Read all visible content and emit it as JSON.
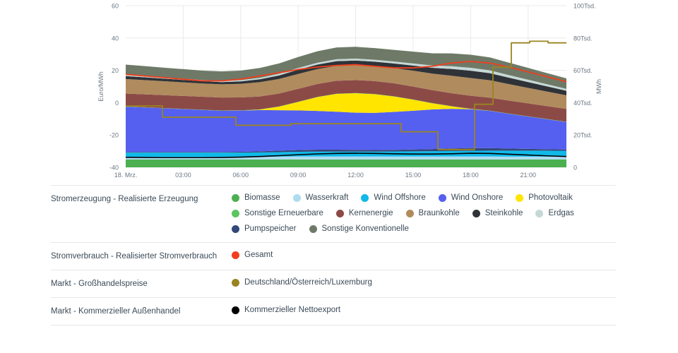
{
  "chart_data": {
    "type": "area",
    "title": "",
    "subtitle": "",
    "xlabel": "",
    "ylabel": "Euro/MWh",
    "y2label": "MWh",
    "grid": true,
    "legend_position": "bottom",
    "x": [
      "18. Mrz.",
      "03:00",
      "06:00",
      "09:00",
      "12:00",
      "15:00",
      "18:00",
      "21:00"
    ],
    "xtick_labels": [
      "18. Mrz.",
      "03:00",
      "06:00",
      "09:00",
      "12:00",
      "15:00",
      "18:00",
      "21:00"
    ],
    "ytick_labels_left": [
      "60",
      "40",
      "20",
      "0",
      "-20",
      "-40"
    ],
    "ytick_values_left": [
      60,
      40,
      20,
      0,
      -20,
      -40
    ],
    "ylim": [
      -40,
      60
    ],
    "ytick_labels_right": [
      "100Tsd.",
      "80Tsd.",
      "60Tsd.",
      "40Tsd.",
      "20Tsd.",
      "0"
    ],
    "ytick_values_right": [
      100000,
      80000,
      60000,
      40000,
      20000,
      0
    ],
    "y2lim": [
      0,
      100000
    ],
    "hours": [
      0,
      1,
      2,
      3,
      4,
      5,
      6,
      7,
      8,
      9,
      10,
      11,
      12,
      13,
      14,
      15,
      16,
      17,
      18,
      19,
      20,
      21,
      22,
      23
    ],
    "series": [
      {
        "name": "Biomasse",
        "color": "#4caf50",
        "unit": "MWh",
        "stack": "generation",
        "order": 1,
        "values": [
          4800,
          4800,
          4800,
          4800,
          4800,
          4800,
          4800,
          4800,
          4800,
          4800,
          4800,
          4800,
          4800,
          4800,
          4800,
          4800,
          4800,
          4800,
          4800,
          4800,
          4800,
          4800,
          4800,
          4800
        ]
      },
      {
        "name": "Wasserkraft",
        "color": "#aedcf0",
        "unit": "MWh",
        "stack": "generation",
        "order": 2,
        "values": [
          1600,
          1600,
          1600,
          1600,
          1600,
          1600,
          1600,
          1700,
          1800,
          1900,
          1900,
          1900,
          1900,
          1900,
          1900,
          1900,
          1900,
          1900,
          1900,
          1900,
          1800,
          1800,
          1800,
          1800
        ]
      },
      {
        "name": "Wind Offshore",
        "color": "#10b9e8",
        "unit": "MWh",
        "stack": "generation",
        "order": 3,
        "values": [
          2700,
          2700,
          2700,
          2700,
          2700,
          2700,
          2700,
          2700,
          2800,
          2900,
          3000,
          3000,
          3000,
          3000,
          3100,
          3200,
          3300,
          3400,
          3500,
          3600,
          3700,
          3700,
          3700,
          3600
        ]
      },
      {
        "name": "Pumpspeicher",
        "color": "#33487a",
        "unit": "MWh",
        "stack": "generation",
        "order": 4,
        "values": [
          400,
          400,
          400,
          400,
          400,
          400,
          500,
          700,
          900,
          1100,
          1200,
          1200,
          1100,
          1000,
          1000,
          1100,
          1300,
          1600,
          1700,
          1600,
          1300,
          1100,
          900,
          800
        ]
      },
      {
        "name": "Wind Onshore",
        "color": "#5560f0",
        "unit": "MWh",
        "stack": "generation",
        "order": 5,
        "values": [
          28000,
          27500,
          27000,
          26500,
          26000,
          25500,
          25500,
          25500,
          25000,
          24500,
          24000,
          23500,
          23000,
          23000,
          23500,
          24000,
          24500,
          24500,
          24000,
          23000,
          21500,
          20000,
          18500,
          17000
        ]
      },
      {
        "name": "Photovoltaik",
        "color": "#ffe500",
        "unit": "MWh",
        "stack": "generation",
        "order": 6,
        "values": [
          0,
          0,
          0,
          0,
          0,
          0,
          0,
          300,
          2200,
          5200,
          8500,
          11000,
          12000,
          11500,
          9500,
          6800,
          3800,
          1500,
          200,
          0,
          0,
          0,
          0,
          0
        ]
      },
      {
        "name": "Sonstige Erneuerbare",
        "color": "#5dc45f",
        "unit": "MWh",
        "stack": "generation",
        "order": 7,
        "values": [
          150,
          150,
          150,
          150,
          150,
          150,
          150,
          150,
          150,
          150,
          150,
          150,
          150,
          150,
          150,
          150,
          150,
          150,
          150,
          150,
          150,
          150,
          150,
          150
        ]
      },
      {
        "name": "Kernenergie",
        "color": "#8c4a47",
        "unit": "MWh",
        "stack": "generation",
        "order": 8,
        "values": [
          8000,
          8000,
          8000,
          8000,
          8000,
          8000,
          8000,
          8000,
          8000,
          8000,
          8000,
          8000,
          8000,
          8000,
          8000,
          8000,
          8000,
          8000,
          8000,
          8000,
          8000,
          8000,
          8000,
          8000
        ]
      },
      {
        "name": "Braunkohle",
        "color": "#b08b5e",
        "unit": "MWh",
        "stack": "generation",
        "order": 9,
        "values": [
          9000,
          8800,
          8600,
          8400,
          8200,
          8200,
          8400,
          8800,
          9000,
          9200,
          9200,
          9200,
          9200,
          9200,
          9400,
          9800,
          10200,
          10800,
          11000,
          10800,
          10200,
          9600,
          9000,
          8400
        ]
      },
      {
        "name": "Steinkohle",
        "color": "#2f3338",
        "unit": "MWh",
        "stack": "generation",
        "order": 10,
        "values": [
          1800,
          1700,
          1600,
          1500,
          1400,
          1400,
          1500,
          1800,
          2200,
          2600,
          2800,
          2900,
          2900,
          2800,
          2900,
          3200,
          3600,
          4200,
          4500,
          4400,
          4000,
          3600,
          3200,
          2800
        ]
      },
      {
        "name": "Erdgas",
        "color": "#c6d8d6",
        "unit": "MWh",
        "stack": "generation",
        "order": 11,
        "values": [
          900,
          850,
          800,
          780,
          760,
          760,
          800,
          900,
          1000,
          1100,
          1150,
          1200,
          1200,
          1180,
          1200,
          1300,
          1450,
          1700,
          1800,
          1750,
          1600,
          1450,
          1300,
          1150
        ]
      },
      {
        "name": "Sonstige Konventionelle",
        "color": "#6e7a67",
        "unit": "MWh",
        "stack": "generation",
        "order": 12,
        "values": [
          6200,
          6100,
          6000,
          5900,
          5800,
          5800,
          5900,
          6100,
          6400,
          6800,
          7100,
          7300,
          7300,
          7200,
          7200,
          7300,
          7500,
          7900,
          8100,
          8000,
          7700,
          7300,
          6900,
          6500
        ]
      }
    ],
    "lines": [
      {
        "name": "Gesamt",
        "color": "#f03e1e",
        "unit": "MWh",
        "axis": "right",
        "type": "line",
        "values": [
          57500,
          56500,
          55500,
          54500,
          53500,
          53500,
          54500,
          56500,
          58500,
          60500,
          62000,
          63000,
          63500,
          62500,
          61500,
          61500,
          62500,
          64500,
          65500,
          64500,
          62000,
          59000,
          56000,
          53000
        ]
      },
      {
        "name": "Deutschland/Österreich/Luxemburg",
        "color": "#9a8420",
        "unit": "Euro/MWh",
        "axis": "left",
        "type": "step",
        "values": [
          -2,
          -2,
          -9,
          -9,
          -9,
          -9,
          -14,
          -14,
          -14,
          -13,
          -13,
          -13,
          -13,
          -13,
          -13,
          -18,
          -18,
          -29,
          -29,
          -1,
          22,
          37,
          38,
          37
        ]
      },
      {
        "name": "Kommerzieller Nettoexport",
        "color": "#000000",
        "unit": "MWh",
        "axis": "right",
        "type": "line",
        "values": [
          6200,
          6100,
          6000,
          6000,
          6000,
          6100,
          6300,
          6700,
          7200,
          7800,
          8300,
          8600,
          8700,
          8600,
          8400,
          8200,
          8200,
          8400,
          8700,
          8600,
          8100,
          7600,
          7100,
          6700
        ]
      }
    ]
  },
  "axes": {
    "left_title": "Euro/MWh",
    "right_title": "MWh",
    "left_ticks": [
      "60",
      "40",
      "20",
      "0",
      "-20",
      "-40"
    ],
    "right_ticks": [
      "100Tsd.",
      "80Tsd.",
      "60Tsd.",
      "40Tsd.",
      "20Tsd.",
      "0"
    ],
    "bottom_ticks": [
      "18. Mrz.",
      "03:00",
      "06:00",
      "09:00",
      "12:00",
      "15:00",
      "18:00",
      "21:00"
    ]
  },
  "legend": {
    "groups": [
      {
        "category": "Stromerzeugung - Realisierte Erzeugung",
        "items": [
          {
            "label": "Biomasse",
            "color": "#4caf50"
          },
          {
            "label": "Wasserkraft",
            "color": "#aedcf0"
          },
          {
            "label": "Wind Offshore",
            "color": "#10b9e8"
          },
          {
            "label": "Wind Onshore",
            "color": "#5560f0"
          },
          {
            "label": "Photovoltaik",
            "color": "#ffe500"
          },
          {
            "label": "Sonstige Erneuerbare",
            "color": "#5dc45f"
          },
          {
            "label": "Kernenergie",
            "color": "#8c4a47"
          },
          {
            "label": "Braunkohle",
            "color": "#b08b5e"
          },
          {
            "label": "Steinkohle",
            "color": "#2f3338"
          },
          {
            "label": "Erdgas",
            "color": "#c6d8d6"
          },
          {
            "label": "Pumpspeicher",
            "color": "#33487a"
          },
          {
            "label": "Sonstige Konventionelle",
            "color": "#6e7a67"
          }
        ]
      },
      {
        "category": "Stromverbrauch - Realisierter Stromverbrauch",
        "items": [
          {
            "label": "Gesamt",
            "color": "#f03e1e"
          }
        ]
      },
      {
        "category": "Markt - Großhandelspreise",
        "items": [
          {
            "label": "Deutschland/Österreich/Luxemburg",
            "color": "#9a8420"
          }
        ]
      },
      {
        "category": "Markt - Kommerzieller Außenhandel",
        "items": [
          {
            "label": "Kommerzieller Nettoexport",
            "color": "#000000"
          }
        ]
      }
    ]
  }
}
